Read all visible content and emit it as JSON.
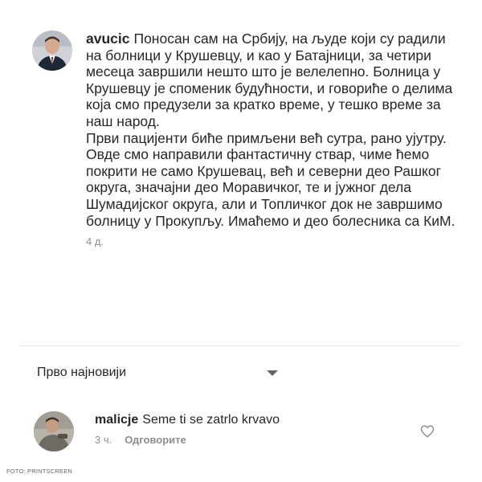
{
  "post": {
    "username": "avucic",
    "text": "Поносан сам на Србију, на људе који су радили на болници у Крушевцу, и као у Батајници, за четири месеца завршили нешто што је велелепно. Болница у Крушевцу је споменик будућности, и говориће о делима која смо предузели за кратко време, у тешко време за наш народ.\nПрви пацијенти биће примљени већ сутра, рано ујутру.\nОвде смо направили фантастичну ствар, чиме ћемо покрити не само Крушевац, већ и северни део Рашког округа, значајни део Моравичког, те и јужног дела Шумадијског округа, али и Топличког док не завршимо болницу у Прокупљу. Имаћемо и део болесника са КиМ.",
    "time": "4 д."
  },
  "sort": {
    "label": "Прво најновији"
  },
  "reply": {
    "username": "malicje",
    "text": "Seme ti se zatrlo krvavo",
    "time": "3 ч.",
    "reply_label": "Одговорите"
  },
  "credit": "FOTO: PRINTSCREEN",
  "icons": {
    "avatar": "avatar",
    "heart": "heart-icon",
    "chevron": "chevron-down-icon"
  },
  "colors": {
    "text": "#262626",
    "muted": "#8e8e8e",
    "divider": "#e6e6e6"
  }
}
